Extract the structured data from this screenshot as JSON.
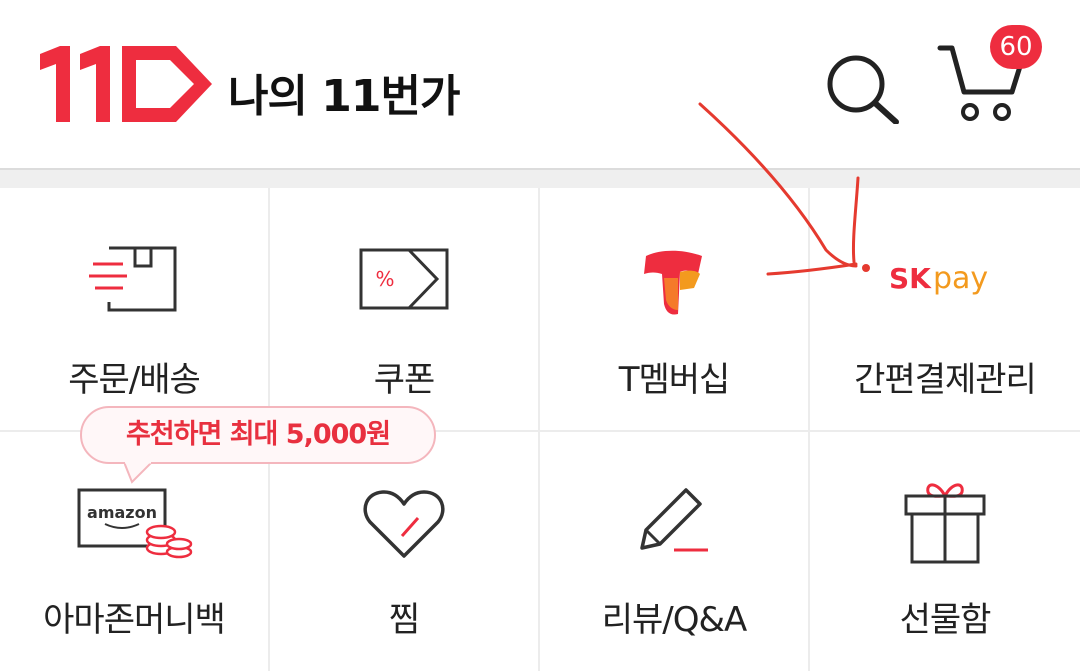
{
  "header": {
    "title": "나의 11번가",
    "logo_icon": "11st-logo-icon",
    "search_icon": "search-icon",
    "cart_icon": "cart-icon",
    "cart_count": "60"
  },
  "menu": {
    "row1": [
      {
        "label": "주문/배송",
        "icon": "delivery-box-icon"
      },
      {
        "label": "쿠폰",
        "icon": "coupon-icon"
      },
      {
        "label": "T멤버십",
        "icon": "t-membership-logo-icon"
      },
      {
        "label": "간편결제관리",
        "icon": "skpay-logo-icon"
      }
    ],
    "row2": [
      {
        "label": "아마존머니백",
        "icon": "amazon-coins-icon"
      },
      {
        "label": "찜",
        "icon": "heart-icon"
      },
      {
        "label": "리뷰/Q&A",
        "icon": "pencil-icon"
      },
      {
        "label": "선물함",
        "icon": "gift-icon"
      }
    ]
  },
  "promo": {
    "text": "추천하면 최대 5,000원"
  },
  "skpay_logo": {
    "sk": "SK",
    "pay": "pay"
  },
  "amazon_logo": {
    "text": "amazon"
  },
  "coupon_icon_text": "%",
  "colors": {
    "brand_red": "#ee2d3f",
    "skpay_orange": "#f39a1e",
    "annotation_red": "#e53a2f"
  }
}
